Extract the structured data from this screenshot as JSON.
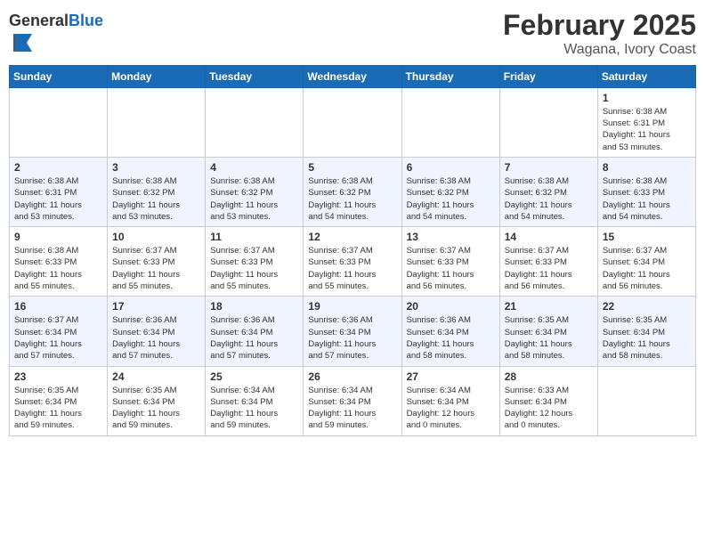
{
  "header": {
    "logo_general": "General",
    "logo_blue": "Blue",
    "month_title": "February 2025",
    "location": "Wagana, Ivory Coast"
  },
  "weekdays": [
    "Sunday",
    "Monday",
    "Tuesday",
    "Wednesday",
    "Thursday",
    "Friday",
    "Saturday"
  ],
  "weeks": [
    [
      {
        "day": "",
        "info": ""
      },
      {
        "day": "",
        "info": ""
      },
      {
        "day": "",
        "info": ""
      },
      {
        "day": "",
        "info": ""
      },
      {
        "day": "",
        "info": ""
      },
      {
        "day": "",
        "info": ""
      },
      {
        "day": "1",
        "info": "Sunrise: 6:38 AM\nSunset: 6:31 PM\nDaylight: 11 hours\nand 53 minutes."
      }
    ],
    [
      {
        "day": "2",
        "info": "Sunrise: 6:38 AM\nSunset: 6:31 PM\nDaylight: 11 hours\nand 53 minutes."
      },
      {
        "day": "3",
        "info": "Sunrise: 6:38 AM\nSunset: 6:32 PM\nDaylight: 11 hours\nand 53 minutes."
      },
      {
        "day": "4",
        "info": "Sunrise: 6:38 AM\nSunset: 6:32 PM\nDaylight: 11 hours\nand 53 minutes."
      },
      {
        "day": "5",
        "info": "Sunrise: 6:38 AM\nSunset: 6:32 PM\nDaylight: 11 hours\nand 54 minutes."
      },
      {
        "day": "6",
        "info": "Sunrise: 6:38 AM\nSunset: 6:32 PM\nDaylight: 11 hours\nand 54 minutes."
      },
      {
        "day": "7",
        "info": "Sunrise: 6:38 AM\nSunset: 6:32 PM\nDaylight: 11 hours\nand 54 minutes."
      },
      {
        "day": "8",
        "info": "Sunrise: 6:38 AM\nSunset: 6:33 PM\nDaylight: 11 hours\nand 54 minutes."
      }
    ],
    [
      {
        "day": "9",
        "info": "Sunrise: 6:38 AM\nSunset: 6:33 PM\nDaylight: 11 hours\nand 55 minutes."
      },
      {
        "day": "10",
        "info": "Sunrise: 6:37 AM\nSunset: 6:33 PM\nDaylight: 11 hours\nand 55 minutes."
      },
      {
        "day": "11",
        "info": "Sunrise: 6:37 AM\nSunset: 6:33 PM\nDaylight: 11 hours\nand 55 minutes."
      },
      {
        "day": "12",
        "info": "Sunrise: 6:37 AM\nSunset: 6:33 PM\nDaylight: 11 hours\nand 55 minutes."
      },
      {
        "day": "13",
        "info": "Sunrise: 6:37 AM\nSunset: 6:33 PM\nDaylight: 11 hours\nand 56 minutes."
      },
      {
        "day": "14",
        "info": "Sunrise: 6:37 AM\nSunset: 6:33 PM\nDaylight: 11 hours\nand 56 minutes."
      },
      {
        "day": "15",
        "info": "Sunrise: 6:37 AM\nSunset: 6:34 PM\nDaylight: 11 hours\nand 56 minutes."
      }
    ],
    [
      {
        "day": "16",
        "info": "Sunrise: 6:37 AM\nSunset: 6:34 PM\nDaylight: 11 hours\nand 57 minutes."
      },
      {
        "day": "17",
        "info": "Sunrise: 6:36 AM\nSunset: 6:34 PM\nDaylight: 11 hours\nand 57 minutes."
      },
      {
        "day": "18",
        "info": "Sunrise: 6:36 AM\nSunset: 6:34 PM\nDaylight: 11 hours\nand 57 minutes."
      },
      {
        "day": "19",
        "info": "Sunrise: 6:36 AM\nSunset: 6:34 PM\nDaylight: 11 hours\nand 57 minutes."
      },
      {
        "day": "20",
        "info": "Sunrise: 6:36 AM\nSunset: 6:34 PM\nDaylight: 11 hours\nand 58 minutes."
      },
      {
        "day": "21",
        "info": "Sunrise: 6:35 AM\nSunset: 6:34 PM\nDaylight: 11 hours\nand 58 minutes."
      },
      {
        "day": "22",
        "info": "Sunrise: 6:35 AM\nSunset: 6:34 PM\nDaylight: 11 hours\nand 58 minutes."
      }
    ],
    [
      {
        "day": "23",
        "info": "Sunrise: 6:35 AM\nSunset: 6:34 PM\nDaylight: 11 hours\nand 59 minutes."
      },
      {
        "day": "24",
        "info": "Sunrise: 6:35 AM\nSunset: 6:34 PM\nDaylight: 11 hours\nand 59 minutes."
      },
      {
        "day": "25",
        "info": "Sunrise: 6:34 AM\nSunset: 6:34 PM\nDaylight: 11 hours\nand 59 minutes."
      },
      {
        "day": "26",
        "info": "Sunrise: 6:34 AM\nSunset: 6:34 PM\nDaylight: 11 hours\nand 59 minutes."
      },
      {
        "day": "27",
        "info": "Sunrise: 6:34 AM\nSunset: 6:34 PM\nDaylight: 12 hours\nand 0 minutes."
      },
      {
        "day": "28",
        "info": "Sunrise: 6:33 AM\nSunset: 6:34 PM\nDaylight: 12 hours\nand 0 minutes."
      },
      {
        "day": "",
        "info": ""
      }
    ]
  ]
}
